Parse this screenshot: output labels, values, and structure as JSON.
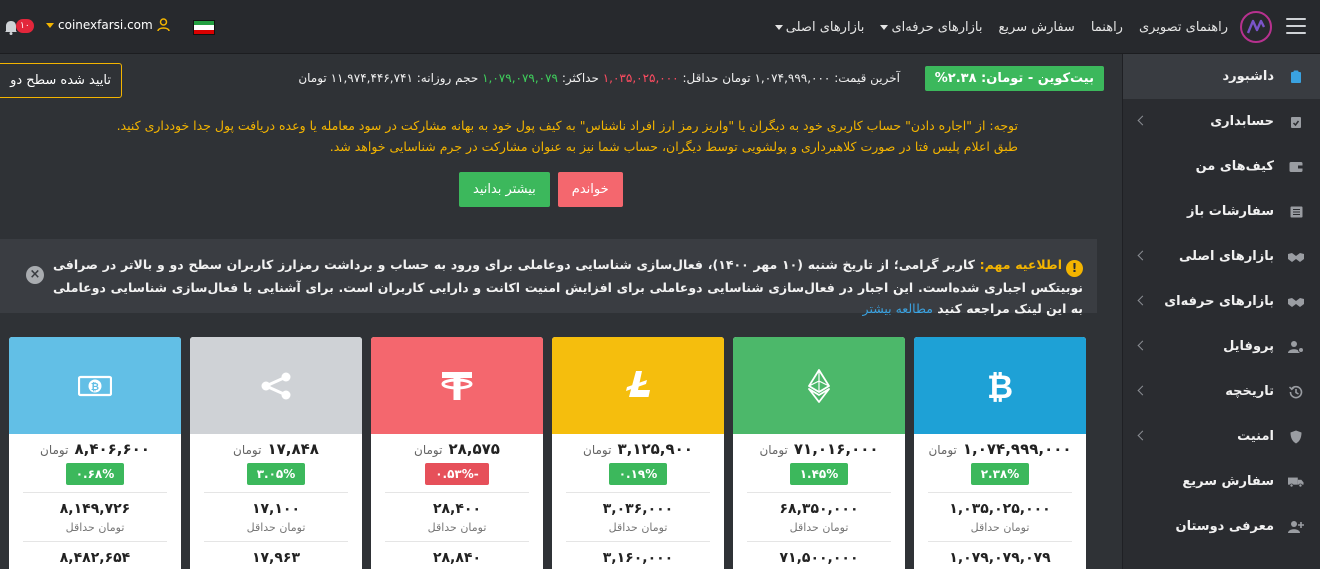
{
  "header": {
    "nav": [
      {
        "label": "بازارهای اصلی",
        "dropdown": true
      },
      {
        "label": "بازارهای حرفه‌ای",
        "dropdown": true
      },
      {
        "label": "سفارش سریع",
        "dropdown": false
      },
      {
        "label": "راهنما",
        "dropdown": false
      },
      {
        "label": "راهنمای تصویری",
        "dropdown": false
      }
    ],
    "username": "coinexfarsi.com",
    "notification_count": "۱۰"
  },
  "sidebar": {
    "items": [
      {
        "label": "داشبورد",
        "icon": "dashboard-icon",
        "active": true,
        "chevron": false
      },
      {
        "label": "حسابداری",
        "icon": "clipboard-check-icon",
        "active": false,
        "chevron": true
      },
      {
        "label": "کیف‌های من",
        "icon": "wallet-icon",
        "active": false,
        "chevron": false
      },
      {
        "label": "سفارشات باز",
        "icon": "list-icon",
        "active": false,
        "chevron": false
      },
      {
        "label": "بازارهای اصلی",
        "icon": "handshake-icon",
        "active": false,
        "chevron": true
      },
      {
        "label": "بازارهای حرفه‌ای",
        "icon": "handshake-icon",
        "active": false,
        "chevron": true
      },
      {
        "label": "پروفایل",
        "icon": "user-gear-icon",
        "active": false,
        "chevron": true
      },
      {
        "label": "تاریخچه",
        "icon": "history-icon",
        "active": false,
        "chevron": true
      },
      {
        "label": "امنیت",
        "icon": "shield-icon",
        "active": false,
        "chevron": true
      },
      {
        "label": "سفارش سریع",
        "icon": "truck-icon",
        "active": false,
        "chevron": false
      },
      {
        "label": "معرفی دوستان",
        "icon": "user-plus-icon",
        "active": false,
        "chevron": false
      }
    ]
  },
  "ticker": {
    "badge": "بیت‌کوین - تومان: ۲.۳۸%",
    "last_price_label": "آخرین قیمت:",
    "last_price": "۱,۰۷۴,۹۹۹,۰۰۰",
    "currency": "تومان",
    "min_label": "حداقل:",
    "min_value": "۱,۰۳۵,۰۲۵,۰۰۰",
    "max_label": "حداکثر:",
    "max_value": "۱,۰۷۹,۰۷۹,۰۷۹",
    "volume_label": "حجم روزانه:",
    "volume_value": "۱۱,۹۷۴,۴۴۶,۷۴۱",
    "volume_unit": "تومان",
    "verify_button": "تایید شده سطح دو"
  },
  "warning": {
    "line1": "توجه: از \"اجاره دادن\" حساب کاربری خود به دیگران یا \"واریز رمز ارز افراد ناشناس\" به کیف پول خود به بهانه مشارکت در سود معامله یا وعده دریافت پول جدا خودداری کنید.",
    "line2": "طبق اعلام پلیس فتا در صورت کلاهبرداری و پولشویی توسط دیگران، حساب شما نیز به عنوان مشارکت در جرم شناسایی خواهد شد.",
    "read_button": "خواندم",
    "more_button": "بیشتر بدانید"
  },
  "announcement": {
    "title": "اطلاعیه مهم:",
    "body": "کاربر گرامی؛ از تاریخ شنبه (۱۰ مهر ۱۴۰۰)، فعال‌سازی شناسایی دوعاملی برای ورود به حساب و برداشت رمزارز کاربران سطح دو و بالاتر در صرافی نوبیتکس اجباری شده‌است. این اجبار در فعال‌سازی شناسایی دوعاملی برای افزایش امنیت اکانت و دارایی کاربران است. برای آشنایی با فعال‌سازی شناسایی دوعاملی به این لینک مراجعه کنید",
    "link": "مطالعه بیشتر"
  },
  "cards": [
    {
      "icon": "bitcoin-icon",
      "color": "#1ea1d6",
      "price": "۱,۰۷۴,۹۹۹,۰۰۰",
      "unit": "تومان",
      "change": "۲.۳۸%",
      "direction": "up",
      "min": "۱,۰۳۵,۰۲۵,۰۰۰",
      "min_label": "تومان حداقل",
      "max": "۱,۰۷۹,۰۷۹,۰۷۹"
    },
    {
      "icon": "ethereum-icon",
      "color": "#4cb86a",
      "price": "۷۱,۰۱۶,۰۰۰",
      "unit": "تومان",
      "change": "۱.۴۵%",
      "direction": "up",
      "min": "۶۸,۳۵۰,۰۰۰",
      "min_label": "تومان حداقل",
      "max": "۷۱,۵۰۰,۰۰۰"
    },
    {
      "icon": "litecoin-icon",
      "color": "#f5be0d",
      "price": "۳,۱۲۵,۹۰۰",
      "unit": "تومان",
      "change": "۰.۱۹%",
      "direction": "up",
      "min": "۳,۰۳۶,۰۰۰",
      "min_label": "تومان حداقل",
      "max": "۳,۱۶۰,۰۰۰"
    },
    {
      "icon": "tether-icon",
      "color": "#f4676e",
      "price": "۲۸,۵۷۵",
      "unit": "تومان",
      "change": "۰.۵۳%-",
      "direction": "down",
      "min": "۲۸,۴۰۰",
      "min_label": "تومان حداقل",
      "max": "۲۸,۸۴۰"
    },
    {
      "icon": "ripple-icon",
      "color": "#cfd2d6",
      "price": "۱۷,۸۴۸",
      "unit": "تومان",
      "change": "۳.۰۵%",
      "direction": "up",
      "min": "۱۷,۱۰۰",
      "min_label": "تومان حداقل",
      "max": "۱۷,۹۶۳"
    },
    {
      "icon": "bitcoin-cash-icon",
      "color": "#62bfe6",
      "price": "۸,۴۰۶,۶۰۰",
      "unit": "تومان",
      "change": "۰.۶۸%",
      "direction": "up",
      "min": "۸,۱۴۹,۷۲۶",
      "min_label": "تومان حداقل",
      "max": "۸,۴۸۲,۶۵۴"
    }
  ]
}
